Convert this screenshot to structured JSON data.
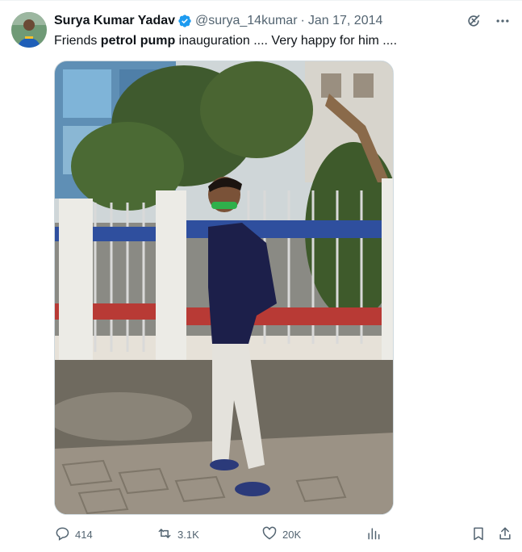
{
  "tweet": {
    "author_name": "Surya Kumar Yadav",
    "handle": "@surya_14kumar",
    "separator": "·",
    "date": "Jan 17, 2014",
    "text_pre": "Friends ",
    "text_bold": "petrol pump",
    "text_post": " inauguration .... Very happy for him ...."
  },
  "actions": {
    "replies": "414",
    "reposts": "3.1K",
    "likes": "20K"
  },
  "icons": {
    "verified": "verified-badge-icon",
    "grok": "grok-icon",
    "more": "more-icon",
    "reply": "reply-icon",
    "repost": "repost-icon",
    "like": "like-icon",
    "views": "views-icon",
    "bookmark": "bookmark-icon",
    "share": "share-icon"
  },
  "colors": {
    "verified": "#1d9bf0",
    "text": "#0f1419",
    "secondary": "#536471"
  }
}
